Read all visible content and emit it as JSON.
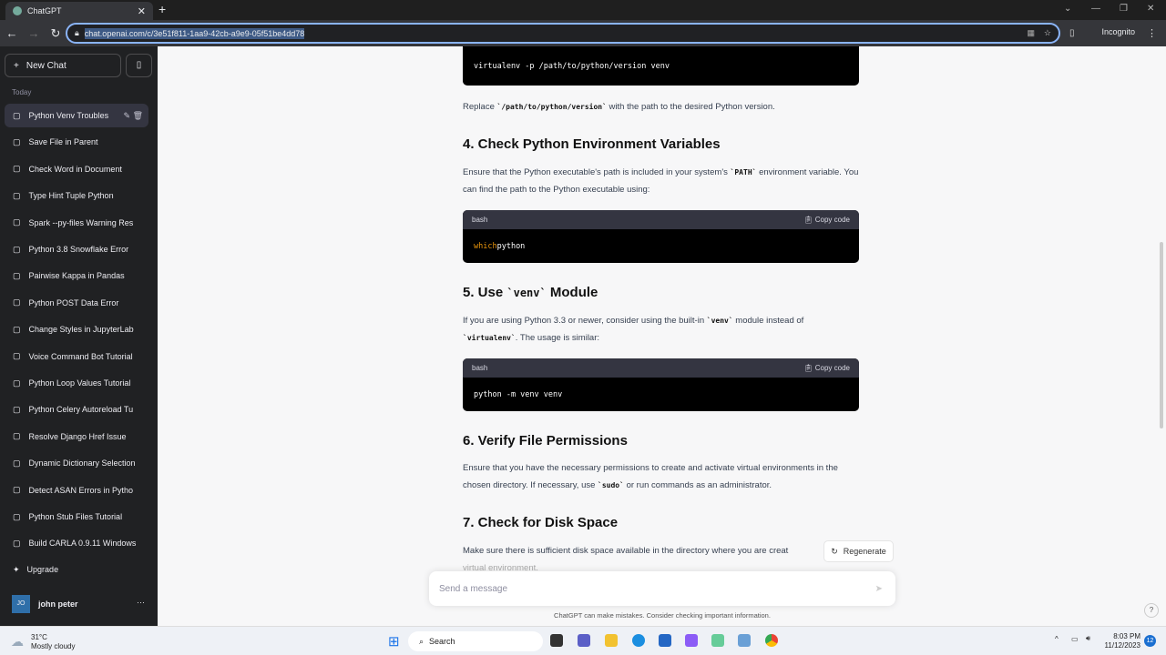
{
  "browser": {
    "tab_title": "ChatGPT",
    "url": "chat.openai.com/c/3e51f811-1aa9-42cb-a9e9-05f51be4dd78",
    "profile": "Incognito"
  },
  "sidebar": {
    "new_chat": "New Chat",
    "section": "Today",
    "items": [
      {
        "label": "Python Venv Troubles"
      },
      {
        "label": "Save File in Parent"
      },
      {
        "label": "Check Word in Document"
      },
      {
        "label": "Type Hint Tuple Python"
      },
      {
        "label": "Spark --py-files Warning Res"
      },
      {
        "label": "Python 3.8 Snowflake Error"
      },
      {
        "label": "Pairwise Kappa in Pandas"
      },
      {
        "label": "Python POST Data Error"
      },
      {
        "label": "Change Styles in JupyterLab"
      },
      {
        "label": "Voice Command Bot Tutorial"
      },
      {
        "label": "Python Loop Values Tutorial"
      },
      {
        "label": "Python Celery Autoreload Tu"
      },
      {
        "label": "Resolve Django Href Issue"
      },
      {
        "label": "Dynamic Dictionary Selection"
      },
      {
        "label": "Detect ASAN Errors in Pytho"
      },
      {
        "label": "Python Stub Files Tutorial"
      },
      {
        "label": "Build CARLA 0.9.11 Windows"
      }
    ],
    "upgrade": "Upgrade",
    "user_initials": "JO",
    "user_name": "john peter"
  },
  "content": {
    "code0": "virtualenv -p /path/to/python/version venv",
    "p0a": "Replace ",
    "p0code": "`/path/to/python/version`",
    "p0b": " with the path to the desired Python version.",
    "h4": "4. Check Python Environment Variables",
    "p4a": "Ensure that the Python executable's path is included in your system's ",
    "p4code": "`PATH`",
    "p4b": " environment variable. You can find the path to the Python executable using:",
    "lang": "bash",
    "copy": "Copy code",
    "code4kw": "which",
    "code4rest": " python",
    "h5a": "5. Use ",
    "h5code": "`venv`",
    "h5b": " Module",
    "p5a": "If you are using Python 3.3 or newer, consider using the built-in ",
    "p5code": "`venv`",
    "p5b": " module instead of ",
    "p5code2": "`virtualenv`",
    "p5c": ". The usage is similar:",
    "code5": "python -m venv venv",
    "h6": "6. Verify File Permissions",
    "p6a": "Ensure that you have the necessary permissions to create and activate virtual environments in the chosen directory. If necessary, use ",
    "p6code": "`sudo`",
    "p6b": " or run commands as an administrator.",
    "h7": "7. Check for Disk Space",
    "p7": "Make sure there is sufficient disk space available in the directory where you are creat",
    "p7b": "virtual environment."
  },
  "regenerate": "Regenerate",
  "input_placeholder": "Send a message",
  "disclaimer": "ChatGPT can make mistakes. Consider checking important information.",
  "taskbar": {
    "temp": "31°C",
    "weather": "Mostly cloudy",
    "search": "Search",
    "time": "8:03 PM",
    "date": "11/12/2023",
    "notifications": "12"
  }
}
